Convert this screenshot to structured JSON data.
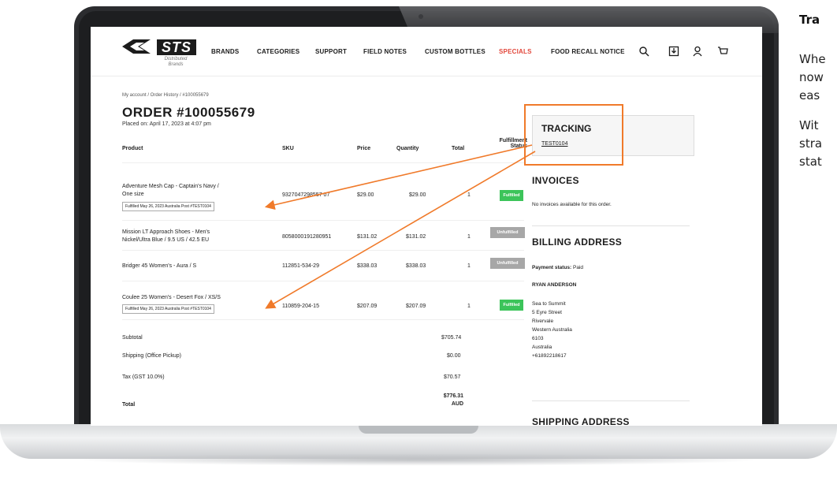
{
  "nav": {
    "logo": {
      "name": "STS",
      "subtitle": "Distributed Brands"
    },
    "items": [
      "BRANDS",
      "CATEGORIES",
      "SUPPORT",
      "FIELD NOTES",
      "CUSTOM BOTTLES",
      "SPECIALS",
      "FOOD RECALL NOTICE"
    ],
    "highlight_color": "#e2483c",
    "icons": [
      "search-icon",
      "download-icon",
      "account-icon",
      "cart-icon"
    ]
  },
  "breadcrumb": "My account / Order History / #100055679",
  "order": {
    "title": "ORDER #100055679",
    "placed": "Placed on: April 17, 2023 at 4:07 pm"
  },
  "table": {
    "headers": {
      "product": "Product",
      "sku": "SKU",
      "price": "Price",
      "quantity": "Quantity",
      "total": "Total",
      "status_line1": "Fulfillment",
      "status_line2": "Status"
    },
    "rows": [
      {
        "product1": "Adventure Mesh Cap - Captain's Navy /",
        "product2": "One size",
        "note": "Fulfilled May 26, 2023 Australia Post #TEST0104",
        "sku": "9327047298557 07",
        "price": "$29.00",
        "total_price": "$29.00",
        "qty": "1",
        "status": "Fulfilled"
      },
      {
        "product1": "Mission LT Approach Shoes - Men's",
        "product2": "Nickel/Ultra Blue / 9.5 US / 42.5 EU",
        "note": "",
        "sku": "8058000191280951",
        "price": "$131.02",
        "total_price": "$131.02",
        "qty": "1",
        "status": "Unfulfilled"
      },
      {
        "product1": "Bridger 45 Women's - Aura / S",
        "product2": "",
        "note": "",
        "sku": "112851-534-29",
        "price": "$338.03",
        "total_price": "$338.03",
        "qty": "1",
        "status": "Unfulfilled"
      },
      {
        "product1": "Coulee 25 Women's - Desert Fox / XS/S",
        "product2": "",
        "note": "Fulfilled May 26, 2023 Australia Post #TEST0104",
        "sku": "110859-204-15",
        "price": "$207.09",
        "total_price": "$207.09",
        "qty": "1",
        "status": "Fulfilled"
      }
    ],
    "status_colors": {
      "fulfilled": "#3cc45a",
      "unfulfilled": "#a7a7a7"
    }
  },
  "summary": {
    "subtotal_label": "Subtotal",
    "subtotal": "$705.74",
    "shipping_label": "Shipping (Office Pickup)",
    "shipping": "$0.00",
    "tax_label": "Tax (GST 10.0%)",
    "tax": "$70.57",
    "total_label": "Total",
    "total": "$776.31",
    "currency": "AUD"
  },
  "tracking": {
    "title": "TRACKING",
    "number": "TEST0104",
    "accent": "#f07a2a"
  },
  "invoices": {
    "title": "INVOICES",
    "text": "No invoices available for this order."
  },
  "billing": {
    "title": "BILLING ADDRESS",
    "payment_label": "Payment status:",
    "payment_value": "Paid",
    "name": "RYAN ANDERSON",
    "lines": [
      "Sea to Summit",
      "5 Eyre Street",
      "Rivervale",
      "Western Australia",
      "6103",
      "Australia",
      "+61892218617"
    ]
  },
  "shipping_title": "SHIPPING ADDRESS",
  "side": {
    "heading": "Tra",
    "lines": [
      "Whe",
      "now",
      "eas",
      "Wit",
      "stra",
      "stat"
    ]
  }
}
